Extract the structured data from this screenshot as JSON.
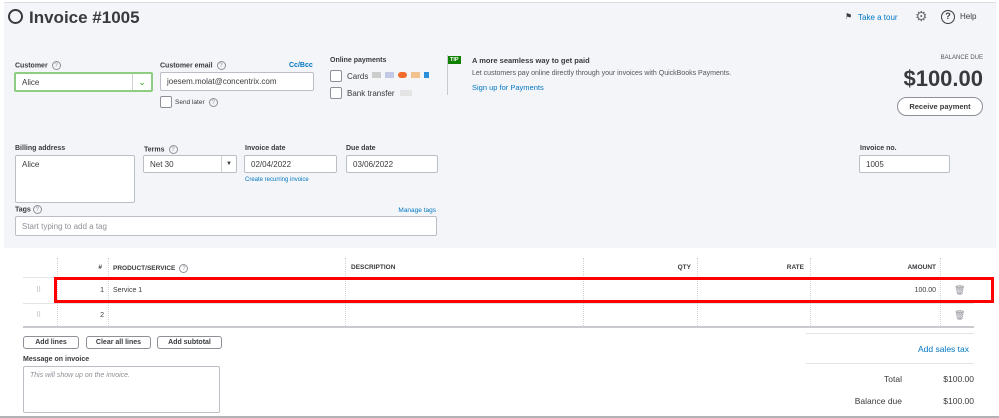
{
  "header": {
    "title": "Invoice #1005",
    "take_tour": "Take a tour",
    "help": "Help"
  },
  "customer": {
    "label": "Customer",
    "value": "Alice"
  },
  "email": {
    "label": "Customer email",
    "value": "joesem.molat@concentrix.com",
    "cc_bcc": "Cc/Bcc",
    "send_later": "Send later"
  },
  "online_payments": {
    "label": "Online payments",
    "cards": "Cards",
    "bank_transfer": "Bank transfer"
  },
  "tip": {
    "badge": "TIP",
    "title": "A more seamless way to get paid",
    "body": "Let customers pay online directly through your invoices with QuickBooks Payments.",
    "link": "Sign up for Payments"
  },
  "balance": {
    "label": "BALANCE DUE",
    "amount": "$100.00",
    "receive_payment": "Receive payment"
  },
  "billing": {
    "label": "Billing address",
    "value": "Alice"
  },
  "terms": {
    "label": "Terms",
    "value": "Net 30"
  },
  "invoice_date": {
    "label": "Invoice date",
    "value": "02/04/2022",
    "recurring_link": "Create recurring invoice"
  },
  "due_date": {
    "label": "Due date",
    "value": "03/06/2022"
  },
  "invoice_no": {
    "label": "Invoice no.",
    "value": "1005"
  },
  "tags": {
    "label": "Tags",
    "manage": "Manage tags",
    "placeholder": "Start typing to add a tag"
  },
  "table": {
    "headers": [
      "#",
      "PRODUCT/SERVICE",
      "DESCRIPTION",
      "QTY",
      "RATE",
      "AMOUNT"
    ],
    "rows": [
      {
        "num": "1",
        "product": "Service 1",
        "description": "",
        "qty": "",
        "rate": "",
        "amount": "100.00"
      },
      {
        "num": "2",
        "product": "",
        "description": "",
        "qty": "",
        "rate": "",
        "amount": ""
      }
    ]
  },
  "actions": {
    "add_lines": "Add lines",
    "clear_all": "Clear all lines",
    "add_subtotal": "Add subtotal",
    "add_sales_tax": "Add sales tax"
  },
  "message": {
    "label": "Message on invoice",
    "placeholder": "This will show up on the invoice."
  },
  "totals": {
    "total_label": "Total",
    "total": "$100.00",
    "balance_label": "Balance due",
    "balance": "$100.00"
  },
  "colors": {
    "accent": "#0077c5",
    "green": "#2ca01c",
    "highlight": "#ff0000"
  }
}
